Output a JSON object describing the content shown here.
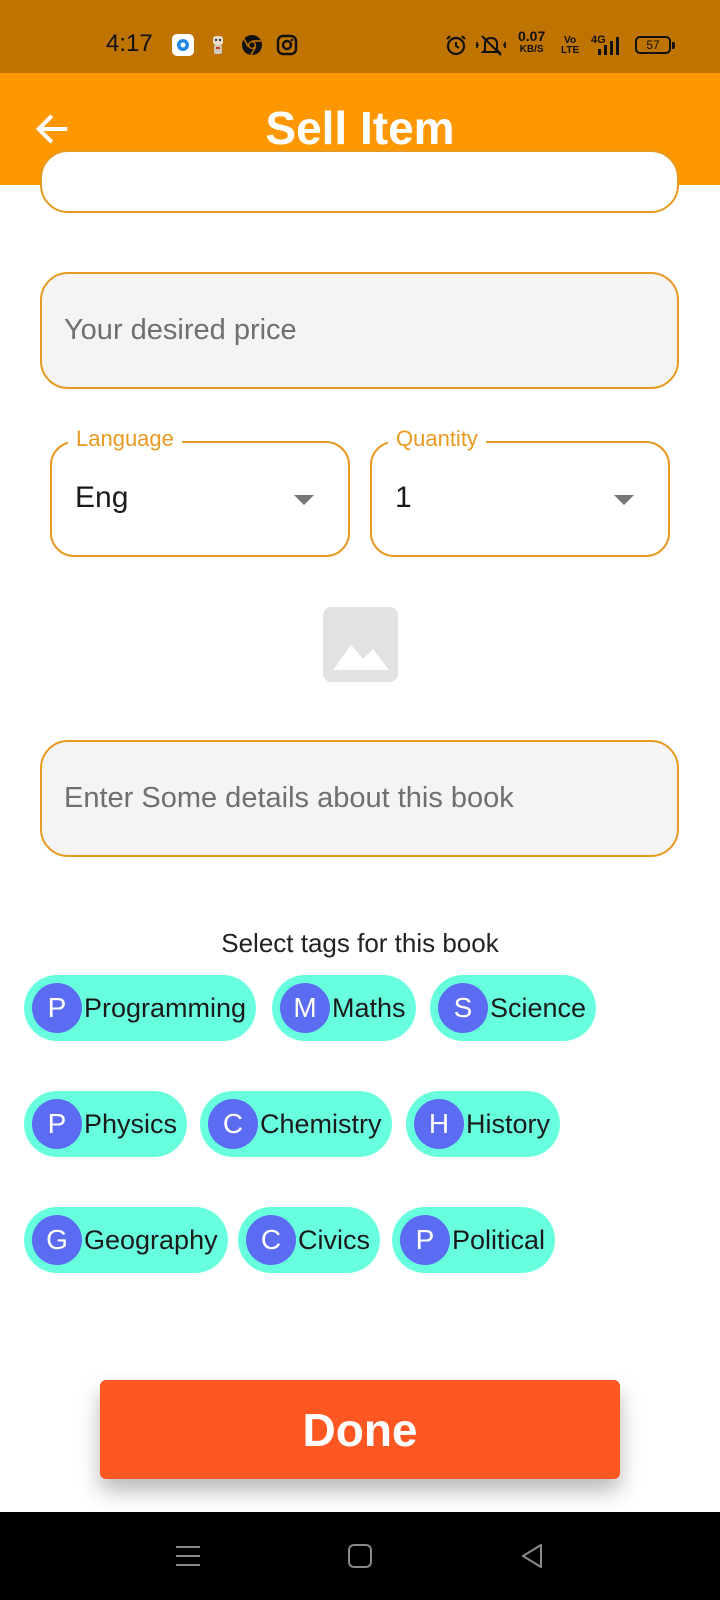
{
  "status_bar": {
    "time": "4:17",
    "net_speed_value": "0.07",
    "net_speed_unit": "KB/S",
    "volte_line1": "Vo",
    "volte_line2": "LTE",
    "network_type": "4G",
    "battery_level": "57",
    "icons": [
      "circle-app-icon",
      "robot-app-icon",
      "chrome-icon",
      "instagram-icon",
      "alarm-icon",
      "mute-icon",
      "signal-icon"
    ]
  },
  "app_bar": {
    "title": "Sell Item",
    "back_icon": "back-arrow-icon",
    "background": "#ff9800"
  },
  "form": {
    "price_placeholder": "Your desired price",
    "language": {
      "label": "Language",
      "value": "Eng"
    },
    "quantity": {
      "label": "Quantity",
      "value": "1"
    },
    "image_icon": "image-placeholder-icon",
    "details_placeholder": "Enter Some details about this book",
    "border_color": "#e89a20"
  },
  "tags": {
    "heading": "Select tags for this book",
    "items": [
      {
        "initial": "P",
        "label": "Programming"
      },
      {
        "initial": "M",
        "label": "Maths"
      },
      {
        "initial": "S",
        "label": "Science"
      },
      {
        "initial": "P",
        "label": "Physics"
      },
      {
        "initial": "C",
        "label": "Chemistry"
      },
      {
        "initial": "H",
        "label": "History"
      },
      {
        "initial": "G",
        "label": "Geography"
      },
      {
        "initial": "C",
        "label": "Civics"
      },
      {
        "initial": "P",
        "label": "Political"
      }
    ],
    "chip_color": "#67ffde",
    "avatar_color": "#5b6bf2"
  },
  "done_button": {
    "label": "Done",
    "color": "#ff5722"
  },
  "nav_bar": {
    "icons": [
      "menu-icon",
      "home-icon",
      "back-icon"
    ]
  }
}
